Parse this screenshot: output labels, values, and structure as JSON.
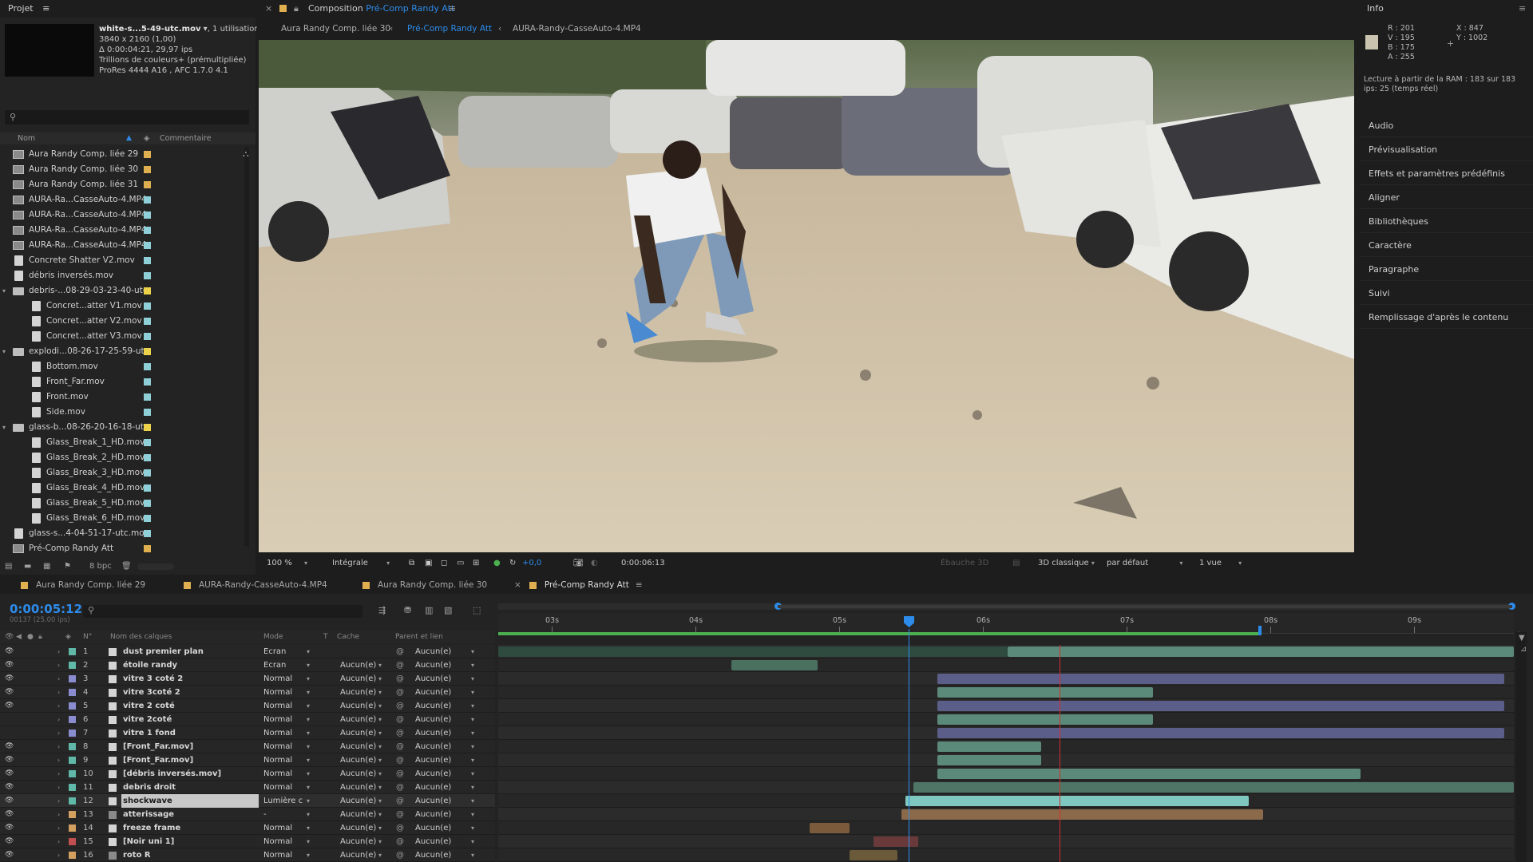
{
  "project": {
    "title": "Projet",
    "filename": "white-s...5-49-utc.mov",
    "usage": ", 1 utilisation",
    "dims": "3840 x 2160 (1,00)",
    "duration": "Δ 0:00:04:21, 29,97 ips",
    "colors": "Trillions de couleurs+ (prémultipliée)",
    "codec": "ProRes 4444 A16 , AFC 1.7.0 4.1",
    "col_name": "Nom",
    "col_comment": "Commentaire",
    "bpc": "8 bpc",
    "items": [
      {
        "name": "Aura Randy Comp. liée 29",
        "indent": 0,
        "kind": "comp",
        "color": "#e0b050"
      },
      {
        "name": "Aura Randy Comp. liée 30",
        "indent": 0,
        "kind": "comp",
        "color": "#e0b050"
      },
      {
        "name": "Aura Randy Comp. liée 31",
        "indent": 0,
        "kind": "comp",
        "color": "#e0b050"
      },
      {
        "name": "AURA-Ra...CasseAuto-4.MP4",
        "indent": 0,
        "kind": "comp",
        "color": "#8ecfd8"
      },
      {
        "name": "AURA-Ra...CasseAuto-4.MP4",
        "indent": 0,
        "kind": "comp",
        "color": "#8ecfd8"
      },
      {
        "name": "AURA-Ra...CasseAuto-4.MP4",
        "indent": 0,
        "kind": "comp",
        "color": "#8ecfd8"
      },
      {
        "name": "AURA-Ra...CasseAuto-4.MP4",
        "indent": 0,
        "kind": "comp",
        "color": "#8ecfd8"
      },
      {
        "name": "Concrete Shatter V2.mov",
        "indent": 0,
        "kind": "file",
        "color": "#8ecfd8"
      },
      {
        "name": "débris inversés.mov",
        "indent": 0,
        "kind": "file",
        "color": "#8ecfd8"
      },
      {
        "name": "debris-...08-29-03-23-40-utc",
        "indent": 0,
        "kind": "folder",
        "color": "#ecd24a"
      },
      {
        "name": "Concret...atter V1.mov",
        "indent": 1,
        "kind": "file",
        "color": "#8ecfd8"
      },
      {
        "name": "Concret...atter V2.mov",
        "indent": 1,
        "kind": "file",
        "color": "#8ecfd8"
      },
      {
        "name": "Concret...atter V3.mov",
        "indent": 1,
        "kind": "file",
        "color": "#8ecfd8"
      },
      {
        "name": "explodi...08-26-17-25-59-utc",
        "indent": 0,
        "kind": "folder",
        "color": "#ecd24a"
      },
      {
        "name": "Bottom.mov",
        "indent": 1,
        "kind": "file",
        "color": "#8ecfd8"
      },
      {
        "name": "Front_Far.mov",
        "indent": 1,
        "kind": "file",
        "color": "#8ecfd8"
      },
      {
        "name": "Front.mov",
        "indent": 1,
        "kind": "file",
        "color": "#8ecfd8"
      },
      {
        "name": "Side.mov",
        "indent": 1,
        "kind": "file",
        "color": "#8ecfd8"
      },
      {
        "name": "glass-b...08-26-20-16-18-utc",
        "indent": 0,
        "kind": "folder",
        "color": "#ecd24a"
      },
      {
        "name": "Glass_Break_1_HD.mov",
        "indent": 1,
        "kind": "file",
        "color": "#8ecfd8"
      },
      {
        "name": "Glass_Break_2_HD.mov",
        "indent": 1,
        "kind": "file",
        "color": "#8ecfd8"
      },
      {
        "name": "Glass_Break_3_HD.mov",
        "indent": 1,
        "kind": "file",
        "color": "#8ecfd8"
      },
      {
        "name": "Glass_Break_4_HD.mov",
        "indent": 1,
        "kind": "file",
        "color": "#8ecfd8"
      },
      {
        "name": "Glass_Break_5_HD.mov",
        "indent": 1,
        "kind": "file",
        "color": "#8ecfd8"
      },
      {
        "name": "Glass_Break_6_HD.mov",
        "indent": 1,
        "kind": "file",
        "color": "#8ecfd8"
      },
      {
        "name": "glass-s...4-04-51-17-utc.mov",
        "indent": 0,
        "kind": "file",
        "color": "#8ecfd8"
      },
      {
        "name": "Pré-Comp Randy Att",
        "indent": 0,
        "kind": "comp",
        "color": "#e0b050"
      }
    ]
  },
  "composition": {
    "label": "Composition",
    "name": "Pré-Comp Randy Att",
    "crumbs": [
      "Aura Randy Comp. liée 30",
      "Pré-Comp Randy Att",
      "AURA-Randy-CasseAuto-4.MP4"
    ],
    "zoom": "100 %",
    "quality": "Intégrale",
    "exposure": "+0,0",
    "timecode": "0:00:06:13",
    "draft": "Ébauche 3D",
    "renderer": "3D classique",
    "camera": "par défaut",
    "views": "1 vue"
  },
  "info": {
    "title": "Info",
    "r": "R : 201",
    "v": "V : 195",
    "b": "B : 175",
    "a": "A : 255",
    "x": "X : 847",
    "y": "Y : 1002",
    "swatch": "#c9c3af",
    "ram": "Lecture à partir de la RAM : 183 sur 183",
    "ips": "ips: 25 (temps réel)",
    "panels": [
      "Audio",
      "Prévisualisation",
      "Effets et paramètres prédéfinis",
      "Aligner",
      "Bibliothèques",
      "Caractère",
      "Paragraphe",
      "Suivi",
      "Remplissage d'après le contenu"
    ]
  },
  "timeline": {
    "tabs": [
      "Aura Randy Comp. liée 29",
      "AURA-Randy-CasseAuto-4.MP4",
      "Aura Randy Comp. liée 30",
      "Pré-Comp Randy Att"
    ],
    "tab_colors": [
      "#e0b050",
      "#e0b050",
      "#e0b050",
      "#e0b050"
    ],
    "time": "0:00:05:12",
    "frames": "00137 (25.00 ips)",
    "cols": {
      "num": "N°",
      "name": "Nom des calques",
      "mode": "Mode",
      "t": "T",
      "cache": "Cache",
      "parent": "Parent et lien"
    },
    "ruler": [
      "03s",
      "04s",
      "05s",
      "06s",
      "07s",
      "08s",
      "09s"
    ],
    "layers": [
      {
        "num": "1",
        "name": "dust premier plan",
        "mode": "Ecran",
        "cache": "",
        "parent": "Aucun(e)",
        "label": "#5fb8a8",
        "eye": true
      },
      {
        "num": "2",
        "name": "étoile randy",
        "mode": "Ecran",
        "cache": "Aucun(e)",
        "parent": "Aucun(e)",
        "label": "#5fb8a8",
        "eye": true
      },
      {
        "num": "3",
        "name": "vitre 3 coté 2",
        "mode": "Normal",
        "cache": "Aucun(e)",
        "parent": "Aucun(e)",
        "label": "#8a8cd0",
        "eye": true
      },
      {
        "num": "4",
        "name": "vitre 3coté 2",
        "mode": "Normal",
        "cache": "Aucun(e)",
        "parent": "Aucun(e)",
        "label": "#8a8cd0",
        "eye": true
      },
      {
        "num": "5",
        "name": "vitre 2 coté",
        "mode": "Normal",
        "cache": "Aucun(e)",
        "parent": "Aucun(e)",
        "label": "#8a8cd0",
        "eye": true
      },
      {
        "num": "6",
        "name": "vitre 2coté",
        "mode": "Normal",
        "cache": "Aucun(e)",
        "parent": "Aucun(e)",
        "label": "#8a8cd0",
        "eye": false
      },
      {
        "num": "7",
        "name": "vitre 1 fond",
        "mode": "Normal",
        "cache": "Aucun(e)",
        "parent": "Aucun(e)",
        "label": "#8a8cd0",
        "eye": false
      },
      {
        "num": "8",
        "name": "[Front_Far.mov]",
        "mode": "Normal",
        "cache": "Aucun(e)",
        "parent": "Aucun(e)",
        "label": "#5fb8a8",
        "eye": true
      },
      {
        "num": "9",
        "name": "[Front_Far.mov]",
        "mode": "Normal",
        "cache": "Aucun(e)",
        "parent": "Aucun(e)",
        "label": "#5fb8a8",
        "eye": true
      },
      {
        "num": "10",
        "name": "[débris inversés.mov]",
        "mode": "Normal",
        "cache": "Aucun(e)",
        "parent": "Aucun(e)",
        "label": "#5fb8a8",
        "eye": true
      },
      {
        "num": "11",
        "name": "debris droit",
        "mode": "Normal",
        "cache": "Aucun(e)",
        "parent": "Aucun(e)",
        "label": "#5fb8a8",
        "eye": true
      },
      {
        "num": "12",
        "name": "shockwave",
        "mode": "Lumière c",
        "cache": "Aucun(e)",
        "parent": "Aucun(e)",
        "label": "#5fb8a8",
        "eye": true
      },
      {
        "num": "13",
        "name": "atterissage",
        "mode": "-",
        "cache": "Aucun(e)",
        "parent": "Aucun(e)",
        "label": "#d4a060",
        "eye": true
      },
      {
        "num": "14",
        "name": "freeze frame",
        "mode": "Normal",
        "cache": "Aucun(e)",
        "parent": "Aucun(e)",
        "label": "#d4a060",
        "eye": true
      },
      {
        "num": "15",
        "name": "[Noir uni 1]",
        "mode": "Normal",
        "cache": "Aucun(e)",
        "parent": "Aucun(e)",
        "label": "#c05050",
        "eye": true
      },
      {
        "num": "16",
        "name": "roto R",
        "mode": "Normal",
        "cache": "Aucun(e)",
        "parent": "Aucun(e)",
        "label": "#d4a060",
        "eye": true
      }
    ]
  }
}
